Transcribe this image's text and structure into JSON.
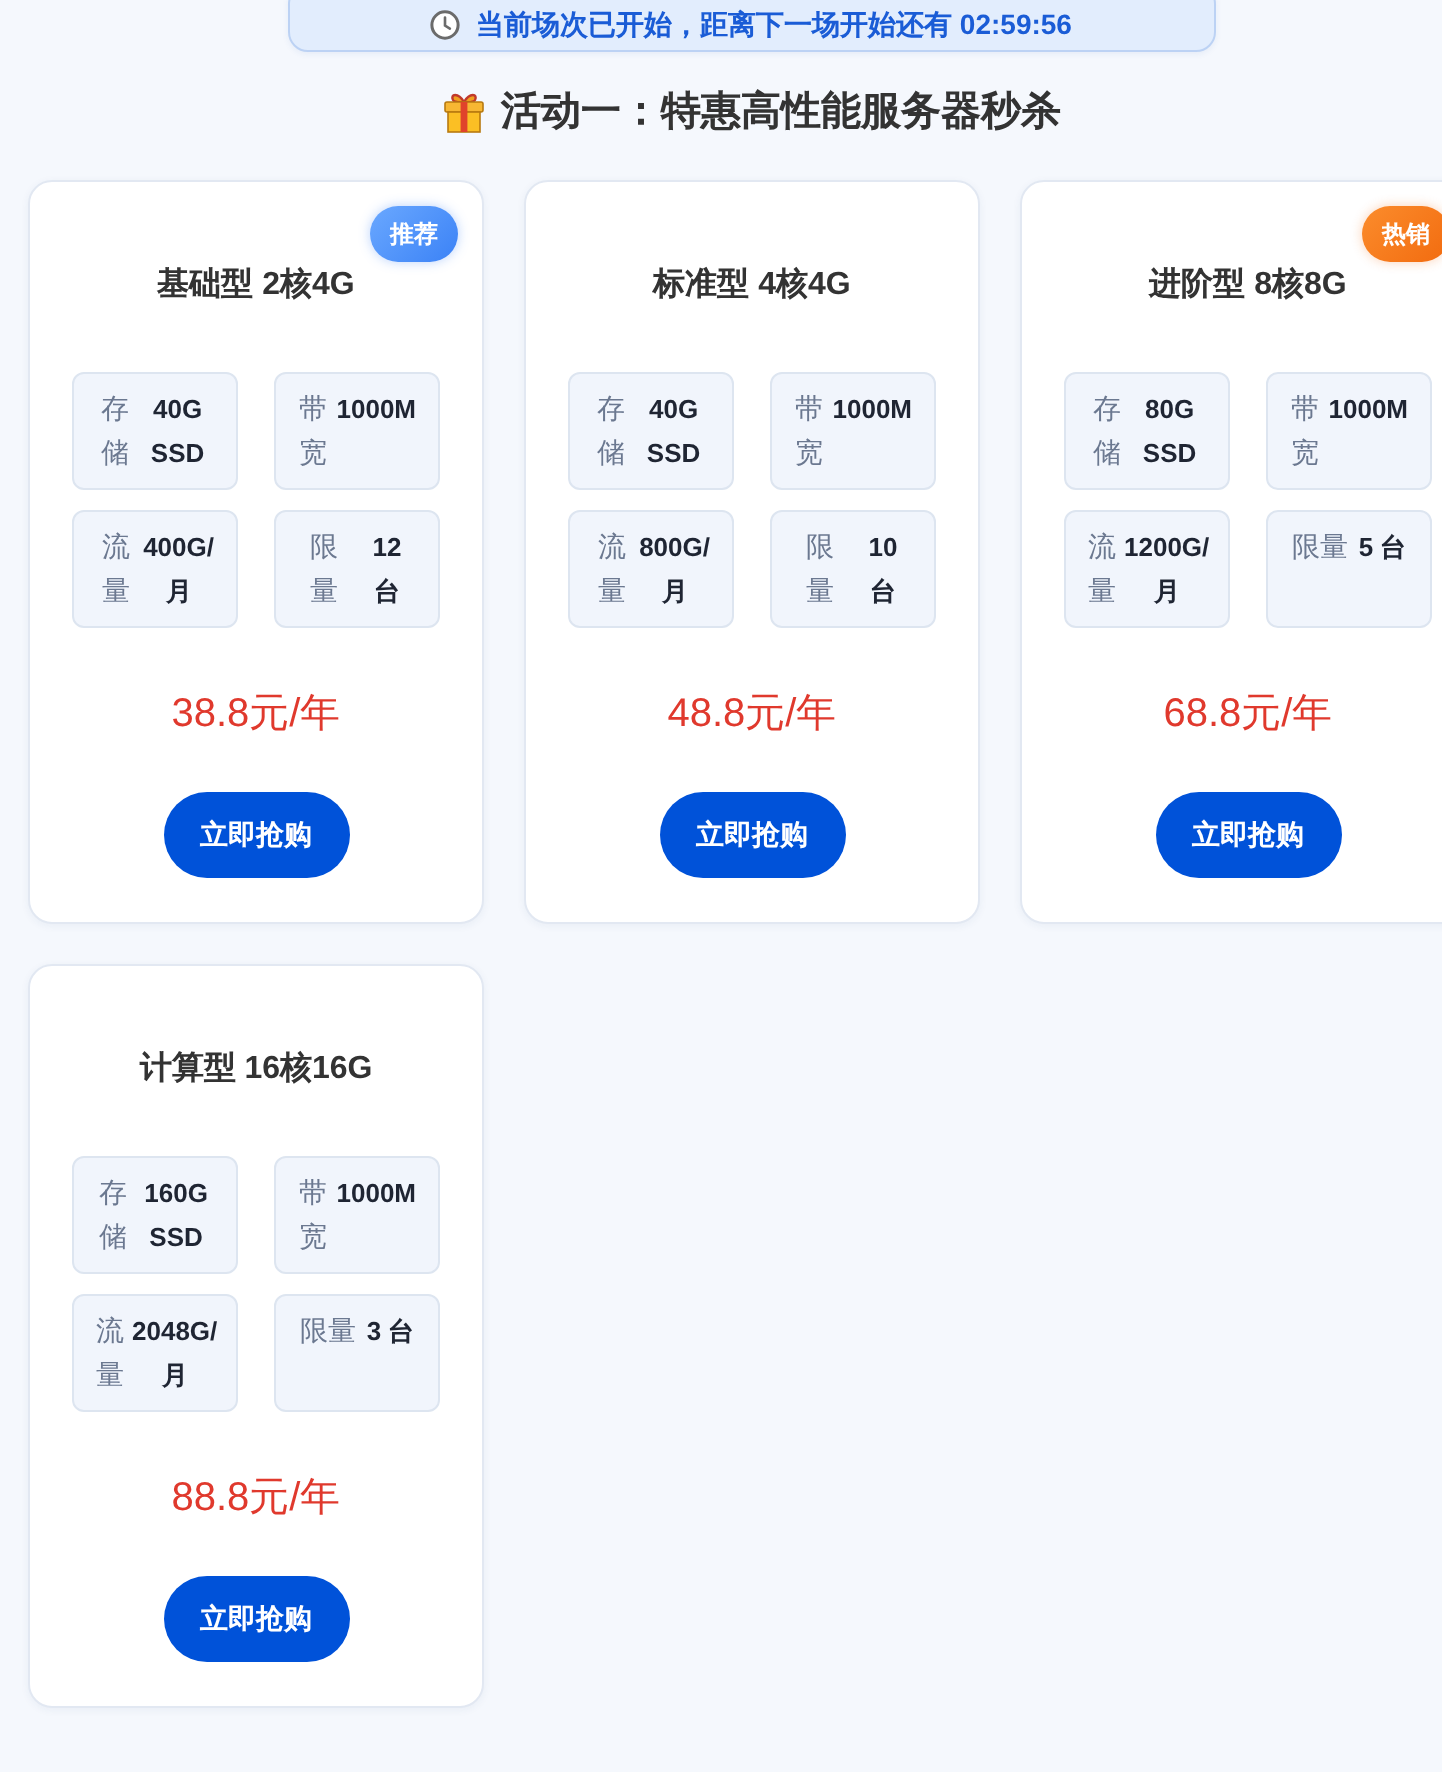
{
  "countdown_banner": {
    "text": "当前场次已开始，距离下一场开始还有 02:59:56"
  },
  "section": {
    "title": "活动一：特惠高性能服务器秒杀"
  },
  "products": [
    {
      "name": "基础型 2核4G",
      "badge": {
        "text": "推荐",
        "kind": "recommended"
      },
      "specs": [
        {
          "label": "存储",
          "value": "40G SSD"
        },
        {
          "label": "带宽",
          "value": "1000M"
        },
        {
          "label": "流量",
          "value": "400G/月"
        },
        {
          "label": "限量",
          "value": "12 台"
        }
      ],
      "price": "38.8元/年",
      "button": "立即抢购"
    },
    {
      "name": "标准型 4核4G",
      "specs": [
        {
          "label": "存储",
          "value": "40G SSD"
        },
        {
          "label": "带宽",
          "value": "1000M"
        },
        {
          "label": "流量",
          "value": "800G/月"
        },
        {
          "label": "限量",
          "value": "10 台"
        }
      ],
      "price": "48.8元/年",
      "button": "立即抢购"
    },
    {
      "name": "进阶型 8核8G",
      "badge": {
        "text": "热销",
        "kind": "hot"
      },
      "specs": [
        {
          "label": "存储",
          "value": "80G SSD"
        },
        {
          "label": "带宽",
          "value": "1000M"
        },
        {
          "label": "流量",
          "value": "1200G/月"
        },
        {
          "label": "限量",
          "value": "5 台"
        }
      ],
      "price": "68.8元/年",
      "button": "立即抢购"
    },
    {
      "name": "计算型 16核16G",
      "specs": [
        {
          "label": "存储",
          "value": "160G SSD"
        },
        {
          "label": "带宽",
          "value": "1000M"
        },
        {
          "label": "流量",
          "value": "2048G/月"
        },
        {
          "label": "限量",
          "value": "3 台"
        }
      ],
      "price": "88.8元/年",
      "button": "立即抢购"
    }
  ]
}
